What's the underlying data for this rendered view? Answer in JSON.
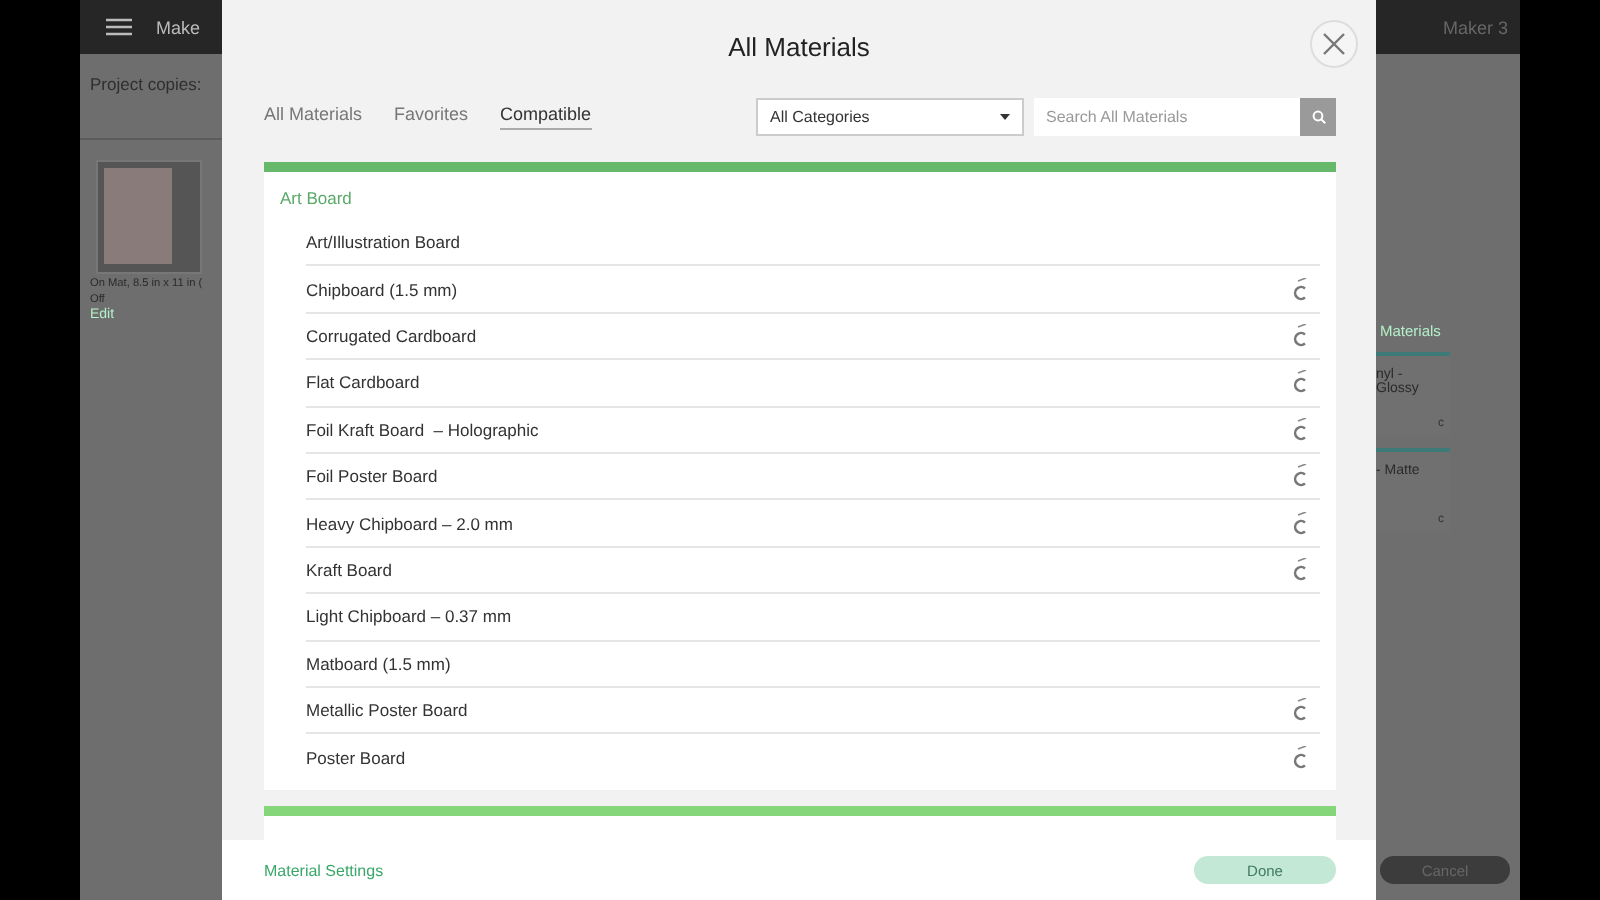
{
  "background": {
    "app_title": "Make",
    "machine": "Maker 3",
    "project_copies_label": "Project copies:",
    "mat_caption": "On Mat, 8.5 in x 11 in (",
    "mat_state": "Off",
    "edit_link": "Edit",
    "materials_link": "Materials",
    "material_cards": [
      {
        "line_1": "nyl -",
        "line_2": "Glossy",
        "badge": "c"
      },
      {
        "line_1": "- Matte",
        "badge": "c"
      }
    ],
    "cancel_button": "Cancel"
  },
  "dialog": {
    "title": "All Materials",
    "tabs": [
      {
        "label": "All Materials",
        "selected": false
      },
      {
        "label": "Favorites",
        "selected": false
      },
      {
        "label": "Compatible",
        "selected": true
      }
    ],
    "category_dropdown": "All Categories",
    "search": {
      "placeholder": "Search All Materials"
    },
    "sections": [
      {
        "name": "Art Board",
        "items": [
          {
            "name": "Art/Illustration Board",
            "custom": false
          },
          {
            "name": "Chipboard (1.5 mm)",
            "custom": true
          },
          {
            "name": "Corrugated Cardboard",
            "custom": true
          },
          {
            "name": "Flat Cardboard",
            "custom": true
          },
          {
            "name": "Foil Kraft Board  – Holographic",
            "custom": true
          },
          {
            "name": "Foil Poster Board",
            "custom": true
          },
          {
            "name": "Heavy Chipboard – 2.0 mm",
            "custom": true
          },
          {
            "name": "Kraft Board",
            "custom": true
          },
          {
            "name": "Light Chipboard – 0.37 mm",
            "custom": false
          },
          {
            "name": "Matboard (1.5 mm)",
            "custom": false
          },
          {
            "name": "Metallic Poster Board",
            "custom": true
          },
          {
            "name": "Poster Board",
            "custom": true
          }
        ]
      }
    ],
    "settings_link": "Material Settings",
    "done_button": {
      "label": "Done",
      "disabled": true
    }
  }
}
